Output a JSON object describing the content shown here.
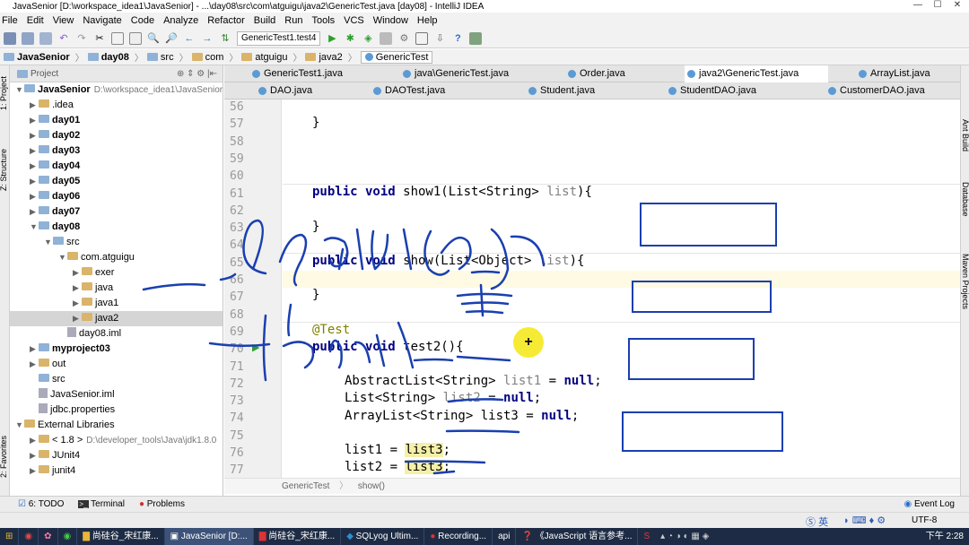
{
  "window": {
    "title": "JavaSenior [D:\\workspace_idea1\\JavaSenior] - ...\\day08\\src\\com\\atguigu\\java2\\GenericTest.java [day08] - IntelliJ IDEA",
    "minimize": "—",
    "maximize": "☐",
    "close": "✕"
  },
  "menu": [
    "File",
    "Edit",
    "View",
    "Navigate",
    "Code",
    "Analyze",
    "Refactor",
    "Build",
    "Run",
    "Tools",
    "VCS",
    "Window",
    "Help"
  ],
  "toolbar": {
    "run_config": "GenericTest1.test4"
  },
  "navbar": {
    "crumbs": [
      "JavaSenior",
      "day08",
      "src",
      "com",
      "atguigu",
      "java2",
      "GenericTest"
    ]
  },
  "left_strip": {
    "project_tab": "1: Project",
    "structure_tab": "Z: Structure",
    "favorites_tab": "2: Favorites"
  },
  "right_strip": {
    "ant_tab": "Ant Build",
    "database_tab": "Database",
    "maven_tab": "Maven Projects"
  },
  "project_panel": {
    "header": "Project",
    "tree": [
      {
        "label": "JavaSenior",
        "path": "D:\\workspace_idea1\\JavaSenior",
        "indent": 0,
        "arrow": "▼",
        "bold": true
      },
      {
        "label": ".idea",
        "indent": 1,
        "arrow": "▶"
      },
      {
        "label": "day01",
        "indent": 1,
        "arrow": "▶",
        "bold": true
      },
      {
        "label": "day02",
        "indent": 1,
        "arrow": "▶",
        "bold": true
      },
      {
        "label": "day03",
        "indent": 1,
        "arrow": "▶",
        "bold": true
      },
      {
        "label": "day04",
        "indent": 1,
        "arrow": "▶",
        "bold": true
      },
      {
        "label": "day05",
        "indent": 1,
        "arrow": "▶",
        "bold": true
      },
      {
        "label": "day06",
        "indent": 1,
        "arrow": "▶",
        "bold": true
      },
      {
        "label": "day07",
        "indent": 1,
        "arrow": "▶",
        "bold": true
      },
      {
        "label": "day08",
        "indent": 1,
        "arrow": "▼",
        "bold": true
      },
      {
        "label": "src",
        "indent": 2,
        "arrow": "▼"
      },
      {
        "label": "com.atguigu",
        "indent": 3,
        "arrow": "▼"
      },
      {
        "label": "exer",
        "indent": 4,
        "arrow": "▶"
      },
      {
        "label": "java",
        "indent": 4,
        "arrow": "▶"
      },
      {
        "label": "java1",
        "indent": 4,
        "arrow": "▶"
      },
      {
        "label": "java2",
        "indent": 4,
        "arrow": "▶",
        "selected": true
      },
      {
        "label": "day08.iml",
        "indent": 3,
        "arrow": ""
      },
      {
        "label": "myproject03",
        "indent": 1,
        "arrow": "▶",
        "bold": true
      },
      {
        "label": "out",
        "indent": 1,
        "arrow": "▶"
      },
      {
        "label": "src",
        "indent": 1,
        "arrow": ""
      },
      {
        "label": "JavaSenior.iml",
        "indent": 1,
        "arrow": ""
      },
      {
        "label": "jdbc.properties",
        "indent": 1,
        "arrow": ""
      },
      {
        "label": "External Libraries",
        "indent": 0,
        "arrow": "▼"
      },
      {
        "label": "< 1.8 >",
        "path": "D:\\developer_tools\\Java\\jdk1.8.0",
        "indent": 1,
        "arrow": "▶"
      },
      {
        "label": "JUnit4",
        "indent": 1,
        "arrow": "▶"
      },
      {
        "label": "junit4",
        "indent": 1,
        "arrow": "▶"
      }
    ]
  },
  "tabs_row1": [
    "GenericTest1.java",
    "java\\GenericTest.java",
    "Order.java",
    "java2\\GenericTest.java",
    "ArrayList.java"
  ],
  "tabs_row2": [
    "DAO.java",
    "DAOTest.java",
    "Student.java",
    "StudentDAO.java",
    "CustomerDAO.java"
  ],
  "active_tab": "java2\\GenericTest.java",
  "line_numbers": [
    "56",
    "57",
    "58",
    "59",
    "60",
    "61",
    "62",
    "63",
    "64",
    "65",
    "66",
    "67",
    "68",
    "69",
    "70",
    "71",
    "72",
    "73",
    "74",
    "75",
    "76",
    "77"
  ],
  "code": {
    "l57": "}",
    "l61_kw": "public void",
    "l61_rest": " show1(List<String> ",
    "l61_param": "list",
    "l61_end": "){",
    "l63": "}",
    "l65_kw": "public void",
    "l65_rest": " show(List<Object> ",
    "l65_param": "list",
    "l65_end": "){",
    "l67": "}",
    "l69": "@Test",
    "l70_kw": "public void",
    "l70_rest": " test2(){",
    "l72_a": "AbstractList<String> ",
    "l72_b": "list1",
    "l72_c": " = ",
    "l72_d": "null",
    "l72_e": ";",
    "l73_a": "List<String> ",
    "l73_b": "list2",
    "l73_c": " = ",
    "l73_d": "null",
    "l73_e": ";",
    "l74_a": "ArrayList<String> list3 = ",
    "l74_d": "null",
    "l74_e": ";",
    "l76_a": "list1 = ",
    "l76_b": "list3",
    "l76_c": ";",
    "l77_a": "list2 = ",
    "l77_b": "list3",
    "l77_c": ";"
  },
  "editor_breadcrumb": {
    "cls": "GenericTest",
    "method": "show()"
  },
  "tool_windows": {
    "todo": "6: TODO",
    "terminal": "Terminal",
    "problems": "Problems",
    "event_log": "Event Log"
  },
  "status": {
    "encoding": "UTF-8",
    "ime": "英"
  },
  "taskbar": {
    "items": [
      "尚硅谷_宋红康...",
      "JavaSenior [D:...",
      "尚硅谷_宋红康...",
      "SQLyog Ultim...",
      "Recording...",
      "《JavaScript 语言参考..."
    ],
    "api": "api",
    "clock": "下午 2:28"
  },
  "colors": {
    "keyword": "#000080",
    "annotation": "#808000",
    "param": "#808080",
    "ink": "#1a3fb0",
    "highlight": "#f5f0a8"
  }
}
